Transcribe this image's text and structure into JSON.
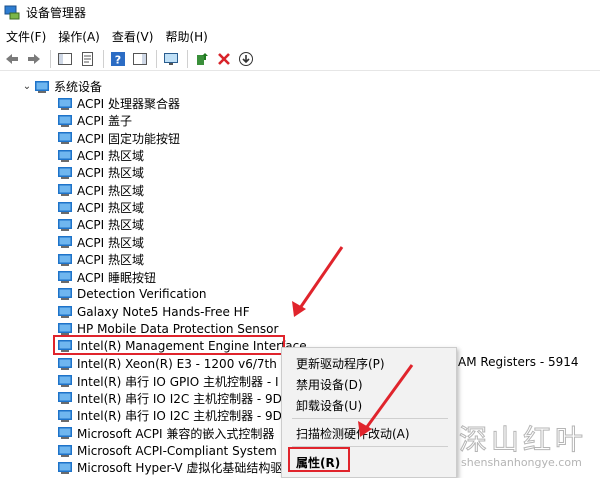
{
  "window": {
    "title": "设备管理器"
  },
  "menubar": {
    "items": [
      "文件(F)",
      "操作(A)",
      "查看(V)",
      "帮助(H)"
    ]
  },
  "tree": {
    "root_label": "系统设备",
    "items": [
      "ACPI 处理器聚合器",
      "ACPI 盖子",
      "ACPI 固定功能按钮",
      "ACPI 热区域",
      "ACPI 热区域",
      "ACPI 热区域",
      "ACPI 热区域",
      "ACPI 热区域",
      "ACPI 热区域",
      "ACPI 热区域",
      "ACPI 睡眠按钮",
      "Detection Verification",
      "Galaxy Note5 Hands-Free HF",
      "HP Mobile Data Protection Sensor",
      "Intel(R) Management Engine Interface",
      "Intel(R) Xeon(R) E3 - 1200 v6/7th G",
      "Intel(R) 串行 IO GPIO 主机控制器 - I",
      "Intel(R) 串行 IO I2C 主机控制器 - 9D",
      "Intel(R) 串行 IO I2C 主机控制器 - 9D",
      "Microsoft ACPI 兼容的嵌入式控制器",
      "Microsoft ACPI-Compliant System",
      "Microsoft Hyper-V 虚拟化基础结构驱"
    ],
    "overflow_text": "AM Registers - 5914"
  },
  "context_menu": {
    "update_driver": "更新驱动程序(P)",
    "disable_device": "禁用设备(D)",
    "uninstall_device": "卸载设备(U)",
    "scan_hardware": "扫描检测硬件改动(A)",
    "properties": "属性(R)"
  },
  "watermark": {
    "main": "深山红叶",
    "sub": "shenshanhongye.com"
  },
  "colors": {
    "annotation_red": "#e0242c"
  }
}
